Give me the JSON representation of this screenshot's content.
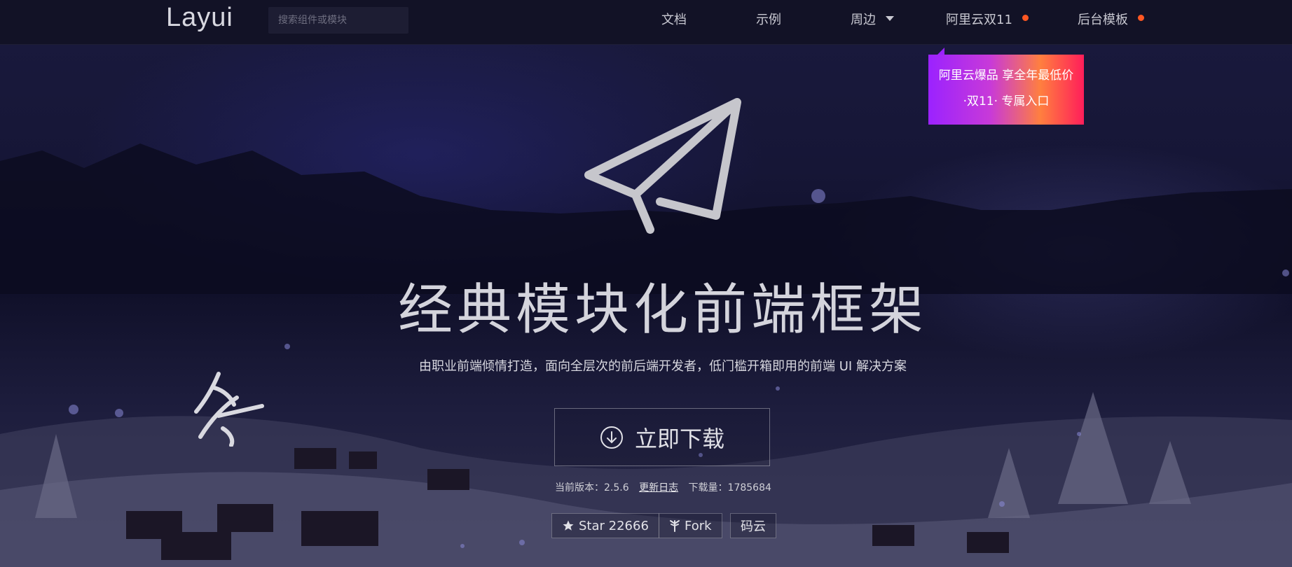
{
  "nav": {
    "logo": "Layui",
    "search_placeholder": "搜索组件或模块",
    "items": [
      {
        "label": "文档"
      },
      {
        "label": "示例"
      },
      {
        "label": "周边"
      },
      {
        "label": "阿里云双11"
      },
      {
        "label": "后台模板"
      }
    ]
  },
  "promo": {
    "line1": "阿里云爆品 享全年最低价",
    "line2": "·双11· 专属入口"
  },
  "hero": {
    "title": "经典模块化前端框架",
    "subtitle": "由职业前端倾情打造，面向全层次的前后端开发者，低门槛开箱即用的前端 UI 解决方案",
    "download_label": "立即下载",
    "version_label": "当前版本：",
    "version_value": "2.5.6",
    "changelog_label": "更新日志",
    "downloads_label": "下载量：",
    "downloads_value": "1785684"
  },
  "repo_buttons": {
    "star_label": "Star 22666",
    "fork_label": "Fork",
    "gitee_label": "码云"
  },
  "colors": {
    "nav_bg": "#121226",
    "accent_dot": "#ff5722",
    "promo_gradient": [
      "#9b22ff",
      "#ff7f3f",
      "#ff1e5a"
    ]
  },
  "icons": [
    "paper-plane-icon",
    "download-circle-icon",
    "star-icon",
    "fork-icon",
    "chevron-down-icon",
    "winter-calligraphy-icon"
  ]
}
